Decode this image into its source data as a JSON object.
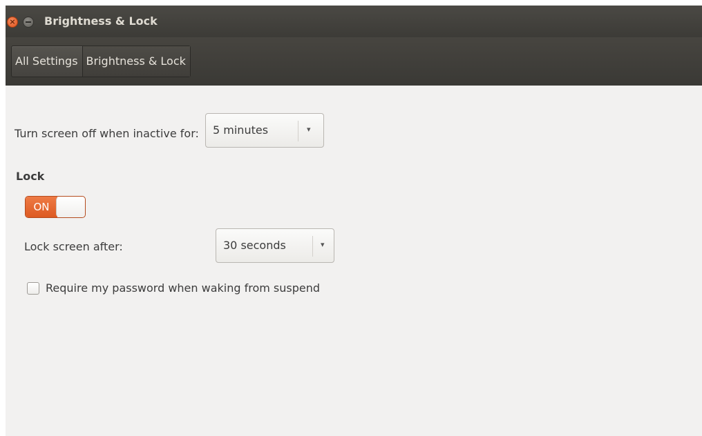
{
  "window": {
    "title": "Brightness & Lock",
    "close_glyph": "×",
    "close_color": "#e0531d"
  },
  "breadcrumb": {
    "items": [
      {
        "label": "All Settings"
      },
      {
        "label": "Brightness & Lock"
      }
    ]
  },
  "screen_off": {
    "label": "Turn screen off when inactive for:",
    "value": "5 minutes",
    "arrow_icon": "▾"
  },
  "lock": {
    "section_title": "Lock",
    "toggle_label": "ON",
    "toggle_state": true,
    "accent_color": "#dd5a22",
    "lock_after_label": "Lock screen after:",
    "lock_after_value": "30 seconds",
    "arrow_icon": "▾",
    "require_password_label": "Require my password when waking from suspend",
    "require_password_checked": false
  }
}
